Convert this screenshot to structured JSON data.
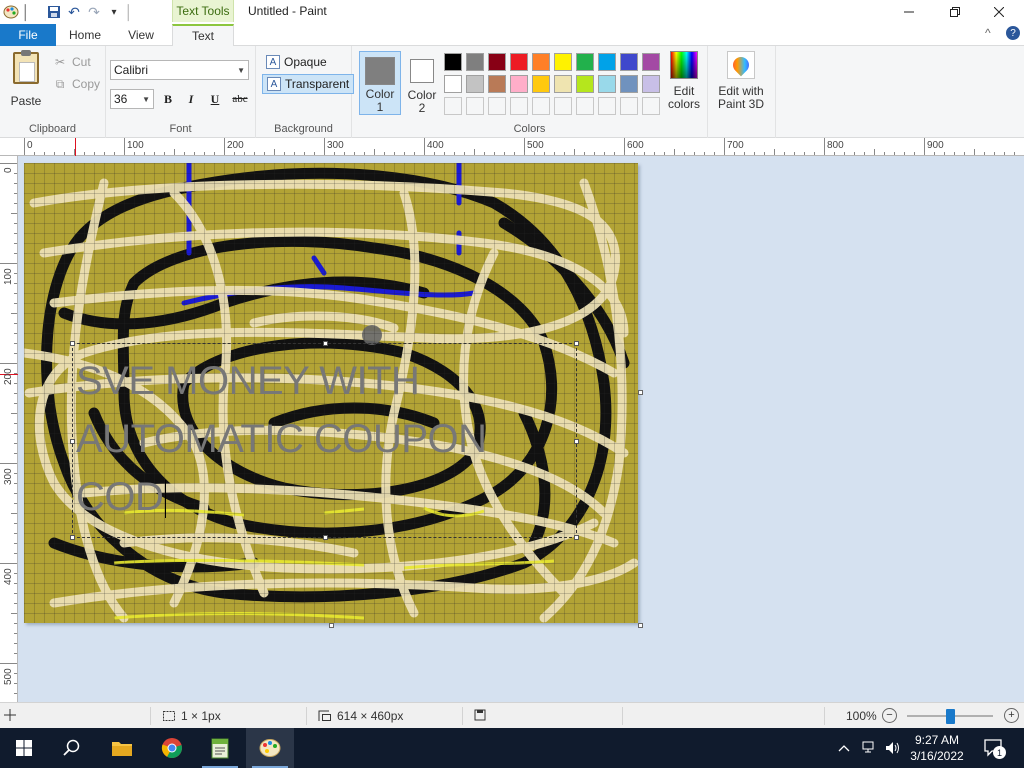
{
  "titlebar": {
    "context_tab_header": "Text Tools",
    "title": "Untitled - Paint"
  },
  "tabs": {
    "file": "File",
    "home": "Home",
    "view": "View",
    "text": "Text"
  },
  "clipboard": {
    "paste": "Paste",
    "cut": "Cut",
    "copy": "Copy",
    "group_label": "Clipboard"
  },
  "font": {
    "name": "Calibri",
    "size": "36",
    "bold": "B",
    "italic": "I",
    "underline": "U",
    "strike": "abc",
    "group_label": "Font"
  },
  "background": {
    "opaque": "Opaque",
    "transparent": "Transparent",
    "group_label": "Background"
  },
  "colors": {
    "color1_label": "Color\n1",
    "color1_line1": "Color",
    "color1_line2": "1",
    "color2_line1": "Color",
    "color2_line2": "2",
    "color1": "#7f7f7f",
    "color2": "#ffffff",
    "edit_line1": "Edit",
    "edit_line2": "colors",
    "group_label": "Colors",
    "palette": [
      "#000000",
      "#7f7f7f",
      "#880015",
      "#ed1c24",
      "#ff7f27",
      "#fff200",
      "#22b14c",
      "#00a2e8",
      "#3f48cc",
      "#a349a4",
      "#ffffff",
      "#c3c3c3",
      "#b97a57",
      "#ffaec9",
      "#ffc90e",
      "#efe4b0",
      "#b5e61d",
      "#99d9ea",
      "#7092be",
      "#c8bfe7",
      "#f5f6f7",
      "#f5f6f7",
      "#f5f6f7",
      "#f5f6f7",
      "#f5f6f7",
      "#f5f6f7",
      "#f5f6f7",
      "#f5f6f7",
      "#f5f6f7",
      "#f5f6f7"
    ]
  },
  "paint3d": {
    "line1": "Edit with",
    "line2": "Paint 3D"
  },
  "ruler": {
    "h_labels": [
      "0",
      "100",
      "200",
      "300",
      "400",
      "500",
      "600",
      "700",
      "800",
      "900"
    ],
    "v_labels": [
      "0",
      "100",
      "200",
      "300",
      "400",
      "500"
    ]
  },
  "canvas": {
    "text_content": "SVE MONEY WITH AUTOMATIC COUPON COD",
    "text_line1": "SVE MONEY WITH",
    "text_line2": "AUTOMATIC COUPON",
    "text_line3": "COD",
    "bg_color": "#b2a335"
  },
  "status": {
    "selection": "1 × 1px",
    "size": "614 × 460px",
    "zoom": "100%",
    "zoom_out": "−",
    "zoom_in": "+"
  },
  "taskbar": {
    "time": "9:27 AM",
    "date": "3/16/2022",
    "notif_count": "1"
  }
}
